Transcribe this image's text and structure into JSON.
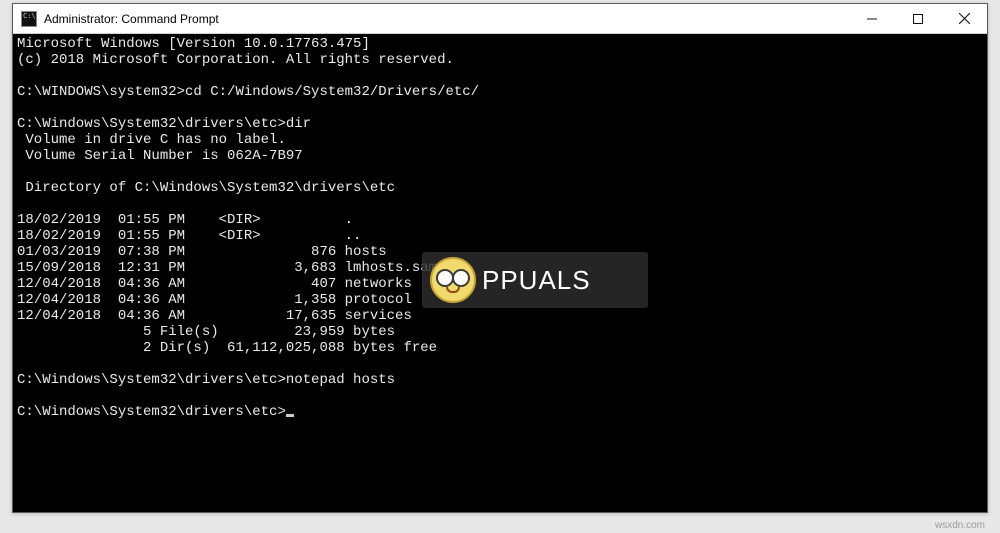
{
  "window": {
    "title": "Administrator: Command Prompt",
    "icon_glyph": "C:\\"
  },
  "console": {
    "header_line1": "Microsoft Windows [Version 10.0.17763.475]",
    "header_line2": "(c) 2018 Microsoft Corporation. All rights reserved.",
    "prompt1_path": "C:\\WINDOWS\\system32>",
    "prompt1_cmd": "cd C:/Windows/System32/Drivers/etc/",
    "prompt2_path": "C:\\Windows\\System32\\drivers\\etc>",
    "prompt2_cmd": "dir",
    "vol_line1": " Volume in drive C has no label.",
    "vol_line2": " Volume Serial Number is 062A-7B97",
    "dir_of": " Directory of C:\\Windows\\System32\\drivers\\etc",
    "row1": "18/02/2019  01:55 PM    <DIR>          .",
    "row2": "18/02/2019  01:55 PM    <DIR>          ..",
    "row3": "01/03/2019  07:38 PM               876 hosts",
    "row4": "15/09/2018  12:31 PM             3,683 lmhosts.sam",
    "row5": "12/04/2018  04:36 AM               407 networks",
    "row6": "12/04/2018  04:36 AM             1,358 protocol",
    "row7": "12/04/2018  04:36 AM            17,635 services",
    "sum1": "               5 File(s)         23,959 bytes",
    "sum2": "               2 Dir(s)  61,112,025,088 bytes free",
    "prompt3_path": "C:\\Windows\\System32\\drivers\\etc>",
    "prompt3_cmd": "notepad hosts",
    "prompt4_path": "C:\\Windows\\System32\\drivers\\etc>"
  },
  "overlay": {
    "logo_text": "PPUALS"
  },
  "watermark": "wsxdn.com"
}
